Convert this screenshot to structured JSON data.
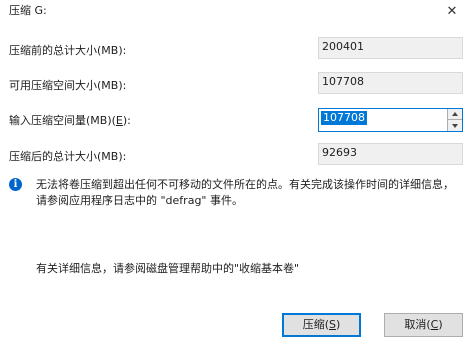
{
  "dialog": {
    "title": "压缩 G:",
    "close_glyph": "✕"
  },
  "rows": {
    "total_before": {
      "label": "压缩前的总计大小(MB):",
      "value": "200401"
    },
    "available": {
      "label": "可用压缩空间大小(MB):",
      "value": "107708"
    },
    "shrink_amount": {
      "label_pre": "输入压缩空间量(MB)(",
      "label_key": "E",
      "label_post": "):",
      "value": "107708"
    },
    "total_after": {
      "label": "压缩后的总计大小(MB):",
      "value": "92693"
    }
  },
  "info": {
    "icon": "info-icon",
    "text": "无法将卷压缩到超出任何不可移动的文件所在的点。有关完成该操作时间的详细信息，请参阅应用程序日志中的 \"defrag\" 事件。"
  },
  "help": {
    "text": "有关详细信息，请参阅磁盘管理帮助中的\"收缩基本卷\""
  },
  "buttons": {
    "shrink": {
      "label": "压缩(",
      "key": "S",
      "suffix": ")"
    },
    "cancel": {
      "label": "取消(",
      "key": "C",
      "suffix": ")"
    }
  },
  "colors": {
    "accent": "#0078d7",
    "info_icon": "#0066cc",
    "button_bg": "#e1e1e1"
  }
}
